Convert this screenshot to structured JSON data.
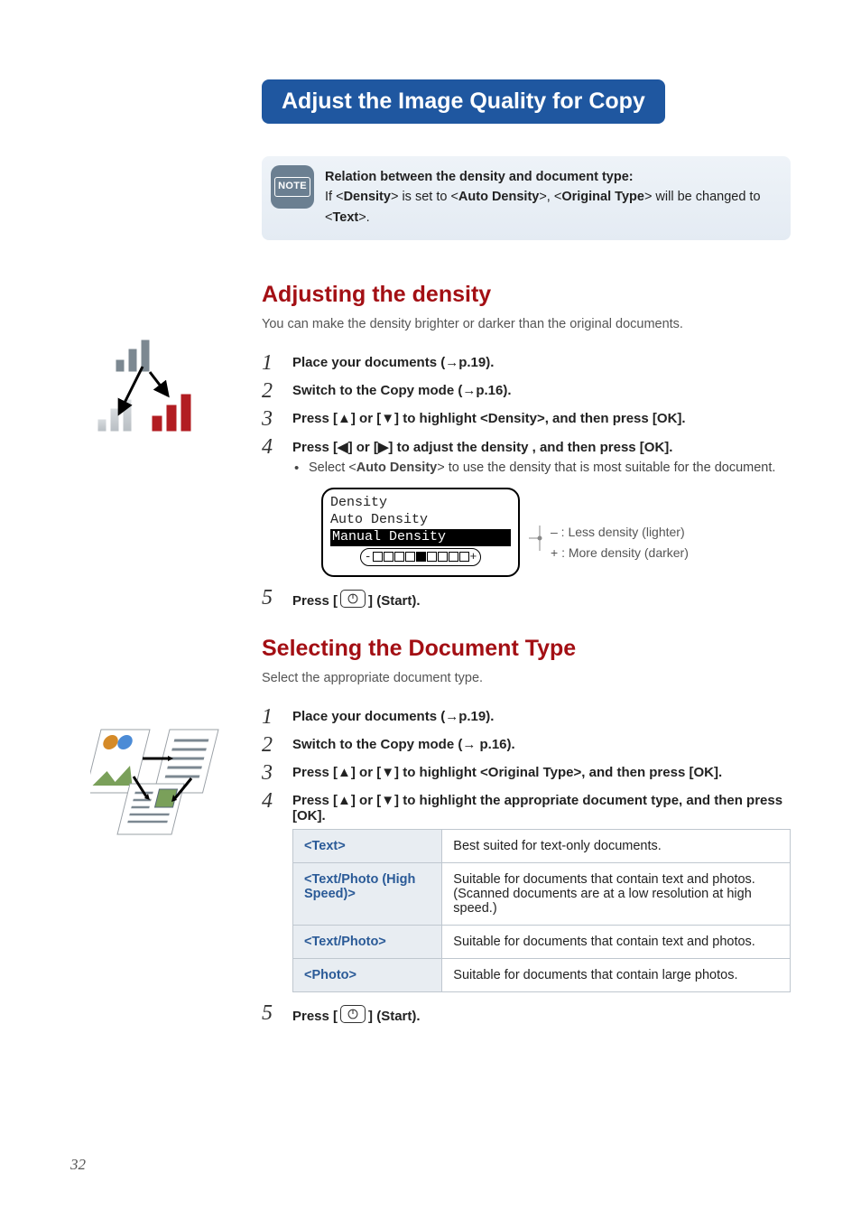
{
  "title": "Adjust the Image Quality for Copy",
  "note": {
    "badge": "NOTE",
    "heading": "Relation between the density and document type:",
    "body_pre": "If <",
    "body_b1": "Density",
    "body_mid1": "> is set to <",
    "body_b2": "Auto Density",
    "body_mid2": ">, <",
    "body_b3": "Original Type",
    "body_mid3": "> will be changed to <",
    "body_b4": "Text",
    "body_post": ">."
  },
  "density": {
    "heading": "Adjusting the density",
    "lead": "You can make the density brighter or darker than the original documents.",
    "steps": {
      "s1": "Place your documents (→p.19).",
      "s2": "Switch to the Copy mode (→p.16).",
      "s3": "Press [▲] or [▼] to highlight <Density>, and then press [OK].",
      "s4": "Press [◀] or [▶] to adjust the density , and then press [OK].",
      "s4_bullet_pre": "Select <",
      "s4_bullet_b": "Auto Density",
      "s4_bullet_post": "> to use the density that is most suitable for the document.",
      "s5_pre": "Press [",
      "s5_post": "] (Start)."
    },
    "lcd": {
      "l1": "Density",
      "l2": " Auto Density",
      "l3": " Manual Density"
    },
    "legend_minus": "– : Less density (lighter)",
    "legend_plus": "+ : More density (darker)"
  },
  "doctype": {
    "heading": "Selecting the Document Type",
    "lead": "Select the appropriate document type.",
    "steps": {
      "s1": "Place your documents (→p.19).",
      "s2": "Switch to the Copy mode (→ p.16).",
      "s3": "Press [▲] or [▼] to highlight <Original Type>, and then press [OK].",
      "s4": "Press [▲] or [▼] to highlight the appropriate document type, and then press [OK].",
      "s5_pre": "Press [",
      "s5_post": "] (Start)."
    },
    "table": {
      "r1k": "<Text>",
      "r1v": "Best suited for text-only documents.",
      "r2k": "<Text/Photo (High Speed)>",
      "r2v": "Suitable for documents that contain text and photos. (Scanned documents are at a low resolution at high speed.)",
      "r3k": "<Text/Photo>",
      "r3v": "Suitable for documents that contain text and photos.",
      "r4k": "<Photo>",
      "r4v": "Suitable for documents that contain large photos."
    }
  },
  "page_number": "32"
}
